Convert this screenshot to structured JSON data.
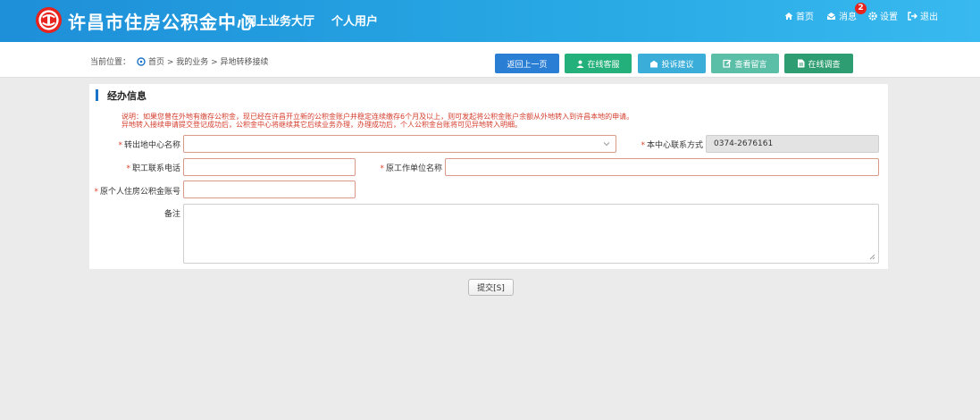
{
  "header": {
    "site_title": "许昌市住房公积金中心",
    "nav": [
      "网上业务大厅",
      "个人用户"
    ],
    "links": {
      "home": "首页",
      "messages": "消息",
      "message_count": "2",
      "settings": "设置",
      "logout": "退出"
    },
    "icons": [
      "home-icon",
      "envelope-icon",
      "gear-icon",
      "logout-icon"
    ],
    "colors": {
      "header_start": "#1e8fd9",
      "header_end": "#38b9ef",
      "badge": "#e8221c"
    }
  },
  "breadcrumb": {
    "label": "当前位置：",
    "path": "首页 > 我的业务 > 异地转移接续"
  },
  "toolbar": {
    "buttons": [
      {
        "label": "返回上一页",
        "color": "#2a7fd4"
      },
      {
        "label": "在线客服",
        "color": "#23b07a"
      },
      {
        "label": "投诉建议",
        "color": "#3aaed8"
      },
      {
        "label": "查看留言",
        "color": "#5bbfa8"
      },
      {
        "label": "在线调查",
        "color": "#2e9e72"
      }
    ]
  },
  "section": {
    "title": "经办信息",
    "note_line1": "说明：如果您曾在外地有缴存公积金，现已经在许昌开立新的公积金账户并稳定连续缴存6个月及以上，则可发起将公积金账户余额从外地转入到许昌本地的申请。",
    "note_line2": "异地转入接续申请提交登记成功后，公积金中心将继续其它后续业务办理，办理成功后，个人公积金台账将可见异地转入明细。"
  },
  "form": {
    "transfer_center": {
      "label": "转出地中心名称",
      "value": ""
    },
    "center_contact": {
      "label": "本中心联系方式",
      "value": "0374-2676161"
    },
    "phone": {
      "label": "职工联系电话",
      "value": ""
    },
    "former_employer": {
      "label": "原工作单位名称",
      "value": ""
    },
    "former_account": {
      "label": "原个人住房公积金账号",
      "value": ""
    },
    "remarks": {
      "label": "备注",
      "value": ""
    },
    "required_mark": "*",
    "submit_label": "提交[S]"
  }
}
